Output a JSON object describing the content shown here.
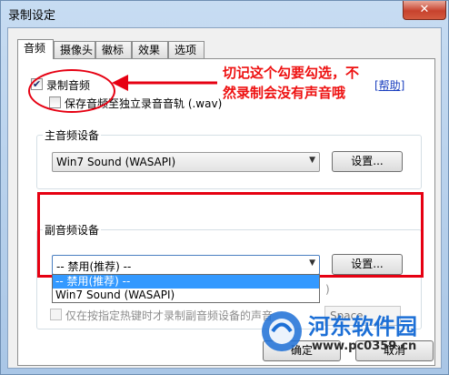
{
  "window": {
    "title": "录制设定",
    "close_glyph": "✕"
  },
  "tabs": [
    {
      "label": "音频",
      "active": true
    },
    {
      "label": "摄像头",
      "active": false
    },
    {
      "label": "徽标",
      "active": false
    },
    {
      "label": "效果",
      "active": false
    },
    {
      "label": "选项",
      "active": false
    }
  ],
  "audio": {
    "record_audio_label": "录制音频",
    "record_audio_checked": true,
    "save_separate_label": "保存音频至独立录音音轨 (.wav)",
    "save_separate_checked": false,
    "help_link": "[帮助]",
    "primary_group_title": "主音频设备",
    "primary_device": "Win7 Sound (WASAPI)",
    "settings_label": "设置...",
    "secondary_group_title": "副音频设备",
    "secondary_device": "-- 禁用(推荐) --",
    "secondary_settings_label": "设置...",
    "dropdown_options": [
      "-- 禁用(推荐) --",
      "Win7 Sound (WASAPI)"
    ],
    "hotkey_label": "仅在按指定热键时才录制副音频设备的声音",
    "hotkey_checked": false,
    "hotkey_value": "Space",
    "partial_paren": ")"
  },
  "footer": {
    "ok_label": "确定",
    "cancel_label": "取消"
  },
  "annotation": {
    "line1": "切记这个勾要勾选，不",
    "line2": "然录制会没有声音哦",
    "color": "#e60012"
  },
  "watermark": {
    "site_name": "河东软件园",
    "url": "www.pc0359.cn"
  }
}
